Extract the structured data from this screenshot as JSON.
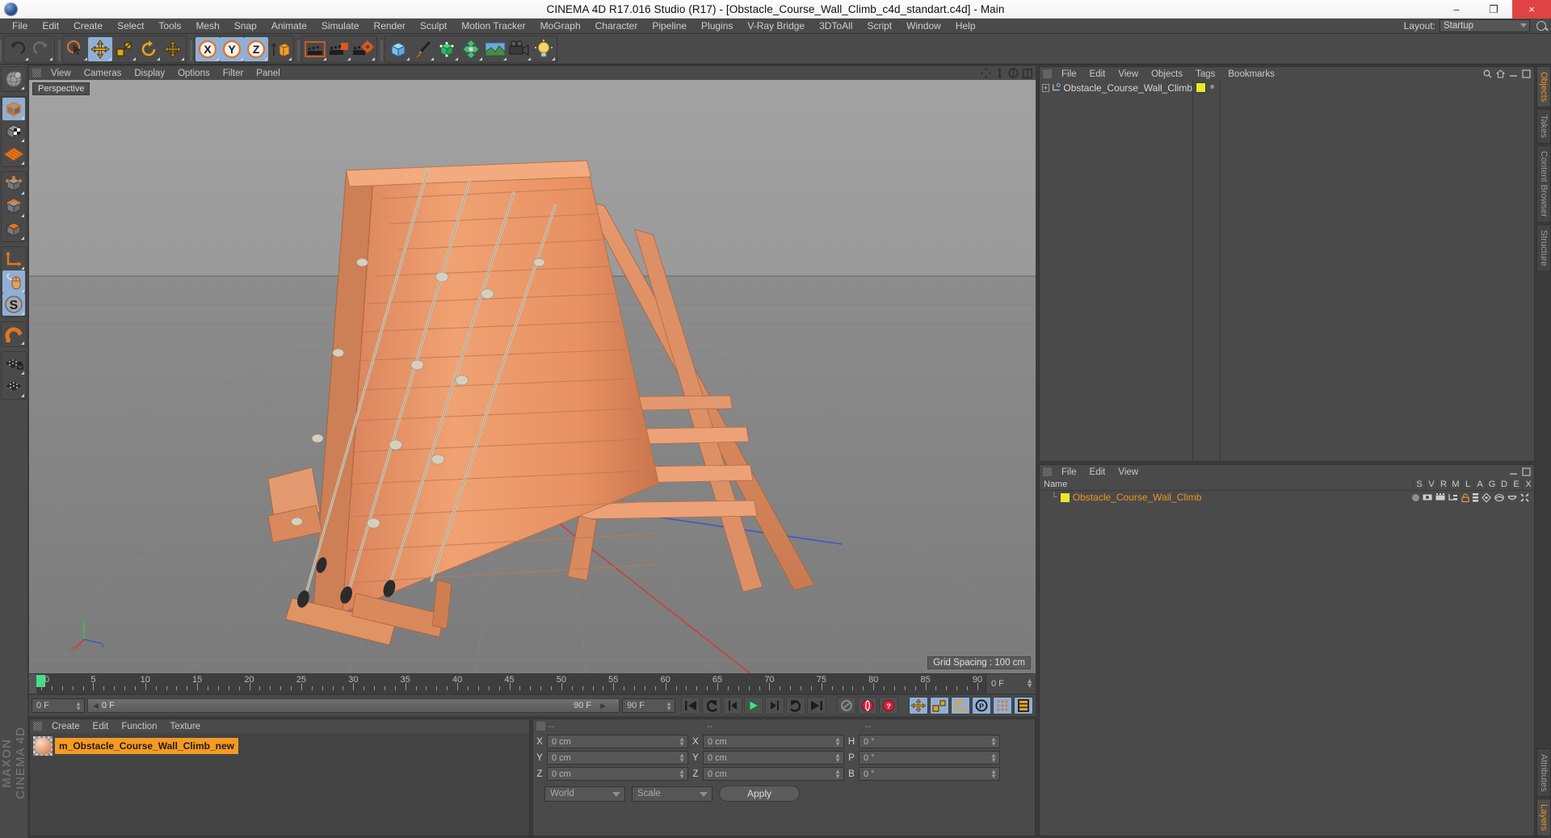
{
  "window": {
    "title": "CINEMA 4D R17.016 Studio (R17) - [Obstacle_Course_Wall_Climb_c4d_standart.c4d] - Main",
    "minimize": "–",
    "maximize": "❐",
    "close": "×"
  },
  "menubar": {
    "items": [
      "File",
      "Edit",
      "Create",
      "Select",
      "Tools",
      "Mesh",
      "Snap",
      "Animate",
      "Simulate",
      "Render",
      "Sculpt",
      "Motion Tracker",
      "MoGraph",
      "Character",
      "Pipeline",
      "Plugins",
      "V-Ray Bridge",
      "3DToAll",
      "Script",
      "Window",
      "Help"
    ],
    "layout_label": "Layout:",
    "layout_value": "Startup"
  },
  "toolbar": {
    "groups": [
      {
        "name": "undo-redo",
        "buttons": [
          {
            "name": "undo-button",
            "icon": "undo-icon",
            "selected": false
          },
          {
            "name": "redo-button",
            "icon": "redo-icon",
            "selected": false
          }
        ]
      },
      {
        "name": "transform-tools",
        "buttons": [
          {
            "name": "live-selection-tool",
            "icon": "cursor-icon",
            "selected": false
          },
          {
            "name": "move-tool",
            "icon": "move-icon",
            "selected": true
          },
          {
            "name": "scale-tool",
            "icon": "scale-icon",
            "selected": false
          },
          {
            "name": "rotate-tool",
            "icon": "rotate-icon",
            "selected": false
          },
          {
            "name": "move-axis-tool",
            "icon": "axis-move-icon",
            "selected": false
          }
        ]
      },
      {
        "name": "axis-locks",
        "buttons": [
          {
            "name": "lock-x-axis",
            "icon": "x-axis-icon",
            "selected": true
          },
          {
            "name": "lock-y-axis",
            "icon": "y-axis-icon",
            "selected": true
          },
          {
            "name": "lock-z-axis",
            "icon": "z-axis-icon",
            "selected": true
          },
          {
            "name": "world-object-axis",
            "icon": "world-axis-icon",
            "selected": false
          }
        ]
      },
      {
        "name": "render-tools",
        "buttons": [
          {
            "name": "render-view-button",
            "icon": "render-view-icon",
            "selected": false
          },
          {
            "name": "render-to-picture-viewer-button",
            "icon": "render-picture-icon",
            "selected": false
          },
          {
            "name": "render-settings-button",
            "icon": "render-settings-icon",
            "selected": false
          }
        ]
      },
      {
        "name": "create-objects",
        "buttons": [
          {
            "name": "add-cube-button",
            "icon": "cube-icon",
            "selected": false
          },
          {
            "name": "add-spline-button",
            "icon": "pen-icon",
            "selected": false
          },
          {
            "name": "add-generator-button",
            "icon": "generator-icon",
            "selected": false
          },
          {
            "name": "add-deformer-button",
            "icon": "deformer-icon",
            "selected": false
          },
          {
            "name": "add-environment-button",
            "icon": "environment-icon",
            "selected": false
          },
          {
            "name": "add-camera-button",
            "icon": "camera-icon",
            "selected": false
          },
          {
            "name": "add-light-button",
            "icon": "light-icon",
            "selected": false
          }
        ]
      }
    ]
  },
  "left_toolbar": {
    "buttons": [
      {
        "name": "make-editable-button",
        "icon": "globe-icon",
        "selected": false
      },
      {
        "name": "model-mode-button",
        "icon": "model-cube-icon",
        "selected": true
      },
      {
        "name": "texture-mode-button",
        "icon": "texture-cube-icon",
        "selected": false
      },
      {
        "name": "workplane-button",
        "icon": "workplane-icon",
        "selected": false
      },
      {
        "name": "points-mode-button",
        "icon": "points-icon",
        "selected": false
      },
      {
        "name": "edges-mode-button",
        "icon": "edges-icon",
        "selected": false
      },
      {
        "name": "polygons-mode-button",
        "icon": "polygons-icon",
        "selected": false
      },
      {
        "name": "axis-mode-button",
        "icon": "axis-icon",
        "selected": false
      },
      {
        "name": "viewport-solo-button",
        "icon": "mouse-icon",
        "selected": true
      },
      {
        "name": "enable-snap-button",
        "icon": "s-circle-icon",
        "selected": true
      },
      {
        "name": "magnet-button",
        "icon": "magnet-icon",
        "selected": false
      },
      {
        "name": "workplane-lock-button",
        "icon": "workplane-lock-icon",
        "selected": false
      },
      {
        "name": "workplane-mode-button",
        "icon": "workplane-mode-icon",
        "selected": false
      }
    ],
    "brand_top": "MAXON",
    "brand_bottom": "CINEMA 4D"
  },
  "viewport": {
    "menu": [
      "View",
      "Cameras",
      "Display",
      "Options",
      "Filter",
      "Panel"
    ],
    "label": "Perspective",
    "grid_spacing": "Grid Spacing : 100 cm",
    "axis_labels": {
      "y": "Y",
      "x": "X",
      "z": "Z"
    },
    "icons": [
      "pan-icon",
      "zoom-icon",
      "rotate-view-icon",
      "maximize-view-icon"
    ]
  },
  "timeline": {
    "start_frame": "0 F",
    "current_frame": "0 F",
    "end_frame_field": "90 F",
    "preview_end": "90 F",
    "right_frame": "0 F",
    "ticks": [
      0,
      5,
      10,
      15,
      20,
      25,
      30,
      35,
      40,
      45,
      50,
      55,
      60,
      65,
      70,
      75,
      80,
      85,
      90
    ],
    "transport": [
      {
        "name": "go-to-start-button",
        "icon": "skip-start-icon"
      },
      {
        "name": "play-backwards-button",
        "icon": "rewind-icon"
      },
      {
        "name": "previous-frame-button",
        "icon": "prev-frame-icon"
      },
      {
        "name": "play-button",
        "icon": "play-icon"
      },
      {
        "name": "next-frame-button",
        "icon": "next-frame-icon"
      },
      {
        "name": "play-forwards-button",
        "icon": "forward-icon"
      },
      {
        "name": "go-to-end-button",
        "icon": "skip-end-icon"
      }
    ],
    "record_tools": [
      {
        "name": "autokey-button",
        "icon": "autokey-icon",
        "selected": false
      },
      {
        "name": "record-active-objects-button",
        "icon": "record-icon",
        "selected": false
      },
      {
        "name": "keyframe-selection-button",
        "icon": "question-icon",
        "selected": false
      }
    ],
    "key_tools": [
      {
        "name": "record-position-button",
        "icon": "position-icon",
        "selected": true
      },
      {
        "name": "record-scale-button",
        "icon": "scale-key-icon",
        "selected": true
      },
      {
        "name": "record-rotation-button",
        "icon": "rotation-key-icon",
        "selected": true
      },
      {
        "name": "record-parameter-button",
        "icon": "param-icon",
        "selected": true
      },
      {
        "name": "record-pla-button",
        "icon": "pla-icon",
        "selected": true
      },
      {
        "name": "timeline-toggle-button",
        "icon": "filmstrip-icon",
        "selected": true
      }
    ]
  },
  "material_manager": {
    "menu": [
      "Create",
      "Edit",
      "Function",
      "Texture"
    ],
    "materials": [
      {
        "name": "m_Obstacle_Course_Wall_Climb_new",
        "selected": true
      }
    ]
  },
  "coordinates_manager": {
    "headers": [
      "--",
      "--",
      "--"
    ],
    "rows": [
      {
        "pos_label": "X",
        "pos_value": "0 cm",
        "size_label": "X",
        "size_value": "0 cm",
        "rot_label": "H",
        "rot_value": "0 °"
      },
      {
        "pos_label": "Y",
        "pos_value": "0 cm",
        "size_label": "Y",
        "size_value": "0 cm",
        "rot_label": "P",
        "rot_value": "0 °"
      },
      {
        "pos_label": "Z",
        "pos_value": "0 cm",
        "size_label": "Z",
        "size_value": "0 cm",
        "rot_label": "B",
        "rot_value": "0 °"
      }
    ],
    "coord_system": "World",
    "mode": "Scale",
    "apply_label": "Apply"
  },
  "object_manager": {
    "menu": [
      "File",
      "Edit",
      "View",
      "Objects",
      "Tags",
      "Bookmarks"
    ],
    "objects": [
      {
        "name": "Obstacle_Course_Wall_Climb",
        "expand": "+",
        "layer_color": "#e8e82a"
      }
    ]
  },
  "layer_manager": {
    "menu": [
      "File",
      "Edit",
      "View"
    ],
    "columns": [
      "Name",
      "S",
      "V",
      "R",
      "M",
      "L",
      "A",
      "G",
      "D",
      "E",
      "X"
    ],
    "rows": [
      {
        "name": "Obstacle_Course_Wall_Climb",
        "color": "#e8e82a"
      }
    ]
  },
  "right_tabs": {
    "top": [
      {
        "label": "Objects",
        "active": true
      },
      {
        "label": "Takes",
        "active": false
      },
      {
        "label": "Content Browser",
        "active": false
      },
      {
        "label": "Structure",
        "active": false
      }
    ],
    "bottom": [
      {
        "label": "Attributes",
        "active": false
      },
      {
        "label": "Layers",
        "active": true
      }
    ]
  },
  "colors": {
    "accent_orange": "#f0941f",
    "selection_blue": "#8fafd8",
    "panel_bg": "#4a4a4a",
    "layer_yellow": "#e8e82a",
    "playhead_green": "#45e08a"
  }
}
